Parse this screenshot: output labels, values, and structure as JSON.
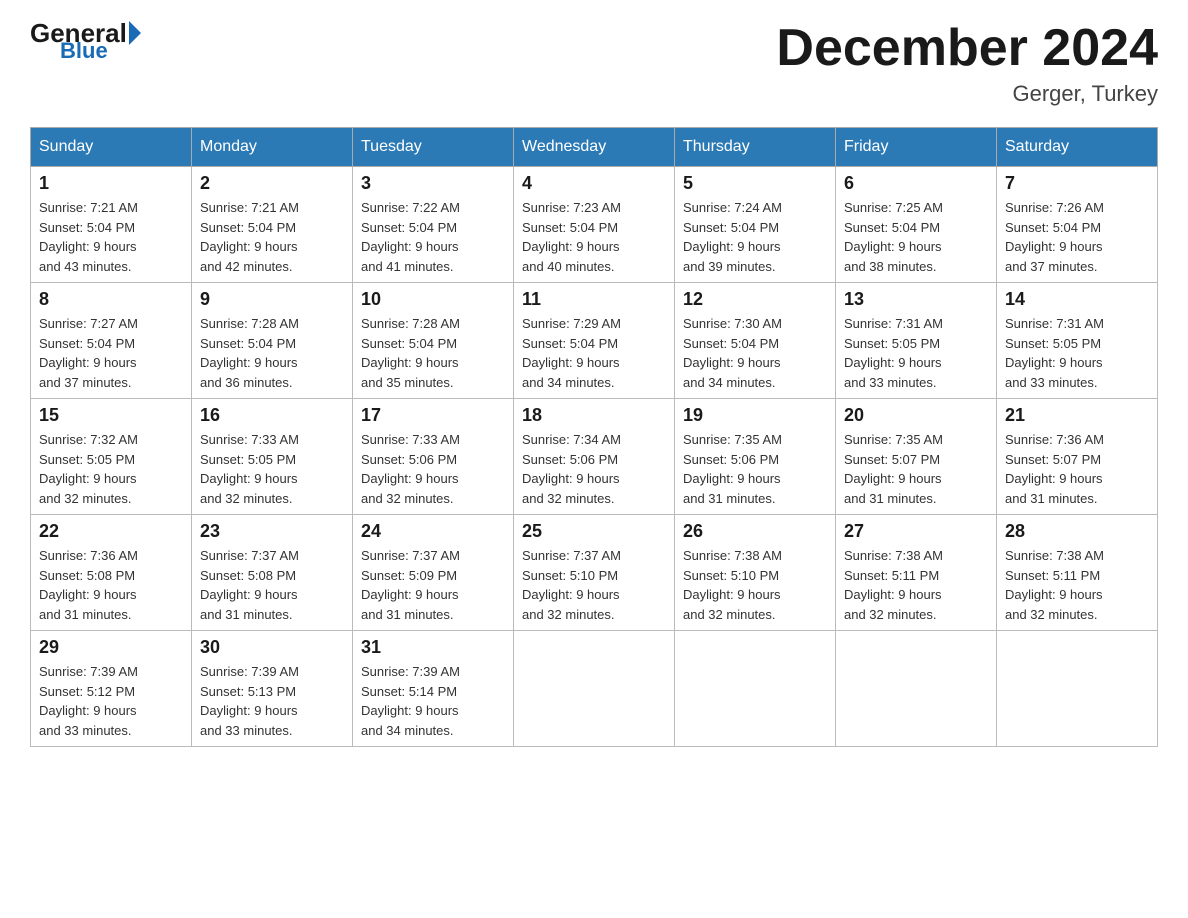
{
  "logo": {
    "general": "General",
    "blue": "Blue"
  },
  "header": {
    "month": "December 2024",
    "location": "Gerger, Turkey"
  },
  "days_of_week": [
    "Sunday",
    "Monday",
    "Tuesday",
    "Wednesday",
    "Thursday",
    "Friday",
    "Saturday"
  ],
  "weeks": [
    [
      {
        "day": "1",
        "sunrise": "7:21 AM",
        "sunset": "5:04 PM",
        "daylight": "9 hours and 43 minutes."
      },
      {
        "day": "2",
        "sunrise": "7:21 AM",
        "sunset": "5:04 PM",
        "daylight": "9 hours and 42 minutes."
      },
      {
        "day": "3",
        "sunrise": "7:22 AM",
        "sunset": "5:04 PM",
        "daylight": "9 hours and 41 minutes."
      },
      {
        "day": "4",
        "sunrise": "7:23 AM",
        "sunset": "5:04 PM",
        "daylight": "9 hours and 40 minutes."
      },
      {
        "day": "5",
        "sunrise": "7:24 AM",
        "sunset": "5:04 PM",
        "daylight": "9 hours and 39 minutes."
      },
      {
        "day": "6",
        "sunrise": "7:25 AM",
        "sunset": "5:04 PM",
        "daylight": "9 hours and 38 minutes."
      },
      {
        "day": "7",
        "sunrise": "7:26 AM",
        "sunset": "5:04 PM",
        "daylight": "9 hours and 37 minutes."
      }
    ],
    [
      {
        "day": "8",
        "sunrise": "7:27 AM",
        "sunset": "5:04 PM",
        "daylight": "9 hours and 37 minutes."
      },
      {
        "day": "9",
        "sunrise": "7:28 AM",
        "sunset": "5:04 PM",
        "daylight": "9 hours and 36 minutes."
      },
      {
        "day": "10",
        "sunrise": "7:28 AM",
        "sunset": "5:04 PM",
        "daylight": "9 hours and 35 minutes."
      },
      {
        "day": "11",
        "sunrise": "7:29 AM",
        "sunset": "5:04 PM",
        "daylight": "9 hours and 34 minutes."
      },
      {
        "day": "12",
        "sunrise": "7:30 AM",
        "sunset": "5:04 PM",
        "daylight": "9 hours and 34 minutes."
      },
      {
        "day": "13",
        "sunrise": "7:31 AM",
        "sunset": "5:05 PM",
        "daylight": "9 hours and 33 minutes."
      },
      {
        "day": "14",
        "sunrise": "7:31 AM",
        "sunset": "5:05 PM",
        "daylight": "9 hours and 33 minutes."
      }
    ],
    [
      {
        "day": "15",
        "sunrise": "7:32 AM",
        "sunset": "5:05 PM",
        "daylight": "9 hours and 32 minutes."
      },
      {
        "day": "16",
        "sunrise": "7:33 AM",
        "sunset": "5:05 PM",
        "daylight": "9 hours and 32 minutes."
      },
      {
        "day": "17",
        "sunrise": "7:33 AM",
        "sunset": "5:06 PM",
        "daylight": "9 hours and 32 minutes."
      },
      {
        "day": "18",
        "sunrise": "7:34 AM",
        "sunset": "5:06 PM",
        "daylight": "9 hours and 32 minutes."
      },
      {
        "day": "19",
        "sunrise": "7:35 AM",
        "sunset": "5:06 PM",
        "daylight": "9 hours and 31 minutes."
      },
      {
        "day": "20",
        "sunrise": "7:35 AM",
        "sunset": "5:07 PM",
        "daylight": "9 hours and 31 minutes."
      },
      {
        "day": "21",
        "sunrise": "7:36 AM",
        "sunset": "5:07 PM",
        "daylight": "9 hours and 31 minutes."
      }
    ],
    [
      {
        "day": "22",
        "sunrise": "7:36 AM",
        "sunset": "5:08 PM",
        "daylight": "9 hours and 31 minutes."
      },
      {
        "day": "23",
        "sunrise": "7:37 AM",
        "sunset": "5:08 PM",
        "daylight": "9 hours and 31 minutes."
      },
      {
        "day": "24",
        "sunrise": "7:37 AM",
        "sunset": "5:09 PM",
        "daylight": "9 hours and 31 minutes."
      },
      {
        "day": "25",
        "sunrise": "7:37 AM",
        "sunset": "5:10 PM",
        "daylight": "9 hours and 32 minutes."
      },
      {
        "day": "26",
        "sunrise": "7:38 AM",
        "sunset": "5:10 PM",
        "daylight": "9 hours and 32 minutes."
      },
      {
        "day": "27",
        "sunrise": "7:38 AM",
        "sunset": "5:11 PM",
        "daylight": "9 hours and 32 minutes."
      },
      {
        "day": "28",
        "sunrise": "7:38 AM",
        "sunset": "5:11 PM",
        "daylight": "9 hours and 32 minutes."
      }
    ],
    [
      {
        "day": "29",
        "sunrise": "7:39 AM",
        "sunset": "5:12 PM",
        "daylight": "9 hours and 33 minutes."
      },
      {
        "day": "30",
        "sunrise": "7:39 AM",
        "sunset": "5:13 PM",
        "daylight": "9 hours and 33 minutes."
      },
      {
        "day": "31",
        "sunrise": "7:39 AM",
        "sunset": "5:14 PM",
        "daylight": "9 hours and 34 minutes."
      },
      null,
      null,
      null,
      null
    ]
  ],
  "labels": {
    "sunrise": "Sunrise:",
    "sunset": "Sunset:",
    "daylight": "Daylight:"
  }
}
